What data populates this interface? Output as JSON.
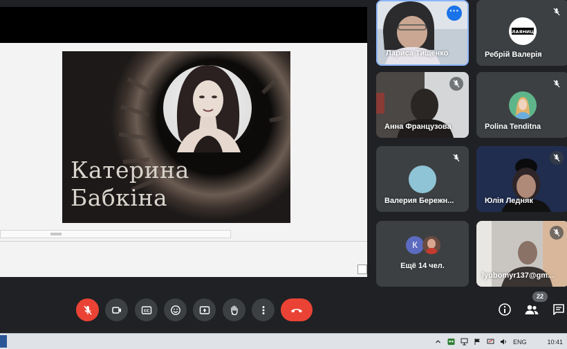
{
  "presentation": {
    "slide_name": "Катерина\nБабкіна"
  },
  "participants": [
    {
      "name": "Лариса Тищенко",
      "muted": false,
      "speaking": true
    },
    {
      "name": "Ребрій Валерія",
      "muted": true,
      "logo_text": "ПЛАЯНИЦЯ"
    },
    {
      "name": "Анна Французова",
      "muted": true
    },
    {
      "name": "Polina Tenditna",
      "muted": true
    },
    {
      "name": "Валерия Бережн...",
      "muted": true
    },
    {
      "name": "Юлія Ледняк",
      "muted": true
    },
    {
      "name": "Ещё 14 чел.",
      "avatar_letter": "К"
    },
    {
      "name": "lyubomyr137@gm...",
      "muted": true
    }
  ],
  "controls": {
    "people_count": "22"
  },
  "taskbar": {
    "language": "ENG",
    "time": "10:41"
  },
  "colors": {
    "background": "#202124",
    "tile": "#3c4043",
    "danger": "#ea4335",
    "accent": "#1a73e8"
  }
}
